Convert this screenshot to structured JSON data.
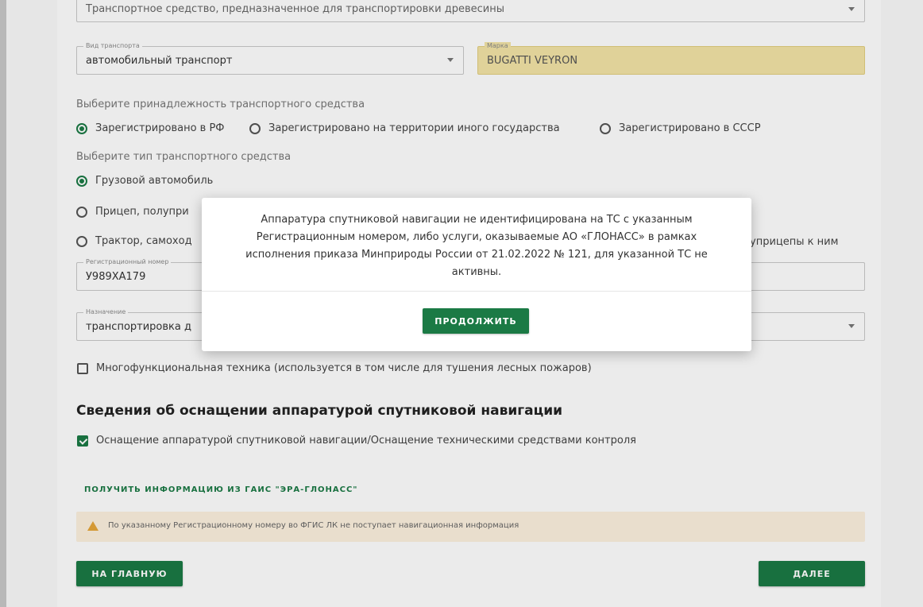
{
  "top_field": {
    "value": "Транспортное средство, предназначенное для транспортировки древесины"
  },
  "transport_type": {
    "label": "Вид транспорта",
    "value": "автомобильный транспорт"
  },
  "brand": {
    "label": "Марка",
    "value": "BUGATTI VEYRON"
  },
  "ownership": {
    "prompt": "Выберите принадлежность транспортного средства",
    "options": [
      "Зарегистрировано в РФ",
      "Зарегистрировано на территории иного государства",
      "Зарегистрировано в СССР"
    ],
    "selected": "Зарегистрировано в РФ"
  },
  "vehicle_type": {
    "prompt": "Выберите тип транспортного средства",
    "options": [
      "Грузовой автомобиль",
      "Прицеп, полупри",
      "Трактор, самоход"
    ],
    "selected": "Грузовой автомобиль",
    "trailing_text": "уприцепы к ним"
  },
  "reg_number": {
    "label": "Регистрационный номер",
    "value": "У989ХА179"
  },
  "purpose": {
    "label": "Назначение",
    "value": "транспортировка д"
  },
  "multifunctional": {
    "label": "Многофункциональная техника (используется в том числе для тушения лесных пожаров)",
    "checked": false
  },
  "navigation_section": {
    "title": "Сведения об оснащении аппаратурой спутниковой навигации",
    "equip_label": "Оснащение аппаратурой спутниковой навигации/Оснащение техническими средствами контроля",
    "equip_checked": true,
    "fetch_link": "ПОЛУЧИТЬ ИНФОРМАЦИЮ ИЗ ГАИС \"ЭРА-ГЛОНАСС\"",
    "warning": "По указанному Регистрационному номеру во ФГИС ЛК не поступает навигационная информация"
  },
  "buttons": {
    "home": "НА ГЛАВНУЮ",
    "next": "ДАЛЕЕ"
  },
  "modal": {
    "message": "Аппаратура спутниковой навигации не идентифицирована на ТС с указанным Регистрационным номером, либо услуги, оказываемые АО «ГЛОНАСС» в рамках исполнения приказа Минприроды России от 21.02.2022 № 121, для указанной ТС не активны.",
    "continue": "ПРОДОЛЖИТЬ"
  },
  "colors": {
    "accent": "#1b7a45",
    "brand_field_bg": "#f3e4a6",
    "warning_bg": "#fdf1df",
    "warning_icon": "#e6a63a"
  }
}
